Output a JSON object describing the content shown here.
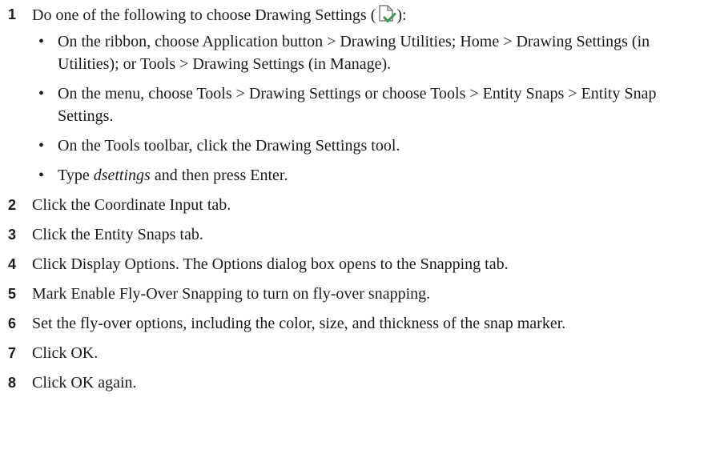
{
  "steps": [
    {
      "number": "1",
      "text_before_icon": "Do one of the following to choose Drawing Settings (",
      "icon": "drawing-settings-icon",
      "text_after_icon": "):",
      "bullets": [
        "On the ribbon, choose Application button > Drawing Utilities; Home > Drawing Settings (in Utilities); or Tools > Drawing Settings (in Manage).",
        "On the menu, choose Tools > Drawing Settings or choose Tools > Entity Snaps > Entity Snap Settings.",
        "On the Tools toolbar, click the Drawing Settings tool."
      ],
      "bullet_type": {
        "prefix": "Type ",
        "command": "dsettings",
        "suffix": " and then press Enter."
      }
    },
    {
      "number": "2",
      "text": "Click the Coordinate Input tab."
    },
    {
      "number": "3",
      "text": "Click the Entity Snaps tab."
    },
    {
      "number": "4",
      "text": "Click Display Options. The Options dialog box opens to the Snapping tab."
    },
    {
      "number": "5",
      "text": "Mark Enable Fly-Over Snapping to turn on fly-over snapping."
    },
    {
      "number": "6",
      "text": "Set the fly-over options, including the color, size, and thickness of the snap marker."
    },
    {
      "number": "7",
      "text": "Click OK."
    },
    {
      "number": "8",
      "text": "Click OK again."
    }
  ],
  "colors": {
    "text": "#1a1a1a",
    "icon_check": "#2e9e44",
    "icon_page": "#6b6b6b"
  }
}
